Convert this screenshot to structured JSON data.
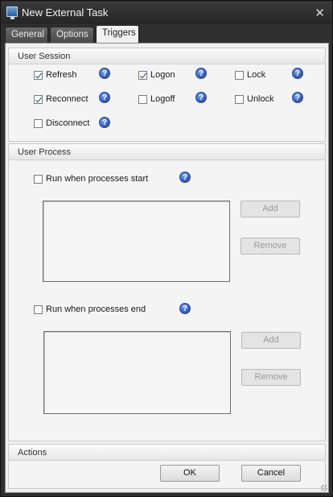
{
  "window": {
    "title": "New External Task",
    "close_glyph": "✕"
  },
  "tabs": [
    {
      "label": "General",
      "active": false
    },
    {
      "label": "Options",
      "active": false
    },
    {
      "label": "Triggers",
      "active": true
    }
  ],
  "user_session": {
    "header": "User Session",
    "items": [
      {
        "label": "Refresh",
        "checked": true
      },
      {
        "label": "Logon",
        "checked": true
      },
      {
        "label": "Lock",
        "checked": false
      },
      {
        "label": "Reconnect",
        "checked": true
      },
      {
        "label": "Logoff",
        "checked": false
      },
      {
        "label": "Unlock",
        "checked": false
      },
      {
        "label": "Disconnect",
        "checked": false
      }
    ]
  },
  "user_process": {
    "header": "User Process",
    "start": {
      "label": "Run when processes start",
      "checked": false,
      "add_label": "Add",
      "remove_label": "Remove"
    },
    "end": {
      "label": "Run when processes end",
      "checked": false,
      "add_label": "Add",
      "remove_label": "Remove"
    }
  },
  "actions": {
    "header": "Actions",
    "ok_label": "OK",
    "cancel_label": "Cancel"
  },
  "icons": {
    "help": "question-mark-icon",
    "app": "monitor-icon"
  },
  "colors": {
    "titlebar": "#2a2a2a",
    "panel": "#f0f0f0",
    "help_icon": "#2a52b8"
  }
}
